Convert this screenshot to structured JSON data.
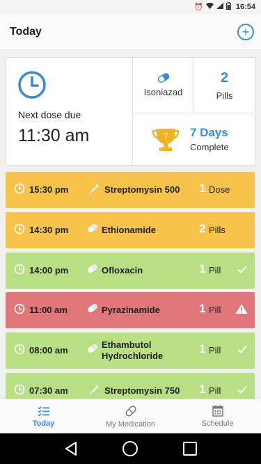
{
  "status_bar": {
    "time": "16:54"
  },
  "app_bar": {
    "title": "Today"
  },
  "summary": {
    "next_dose_label": "Next dose due",
    "next_dose_time": "11:30 am",
    "medication_name": "Isoniazad",
    "pill_count": "2",
    "pill_label": "Pills",
    "streak_value": "7 Days",
    "streak_label": "Complete",
    "trophy_number": "7"
  },
  "doses": [
    {
      "time": "15:30 pm",
      "medication": "Streptomysin 500",
      "count": "1",
      "unit": "Dose",
      "status": "upcoming",
      "color": "#f7c34b",
      "icon": "syringe-icon"
    },
    {
      "time": "14:30 pm",
      "medication": "Ethionamide",
      "count": "2",
      "unit": "Pills",
      "status": "upcoming",
      "color": "#f7c34b",
      "icon": "pill-icon"
    },
    {
      "time": "14:00 pm",
      "medication": "Ofloxacin",
      "count": "1",
      "unit": "Pill",
      "status": "taken",
      "color": "#b9df84",
      "icon": "pill-icon"
    },
    {
      "time": "11:00 am",
      "medication": "Pyrazinamide",
      "count": "1",
      "unit": "Pill",
      "status": "missed",
      "color": "#e0767a",
      "icon": "pill-icon"
    },
    {
      "time": "08:00 am",
      "medication": "Ethambutol Hydrochloride",
      "count": "1",
      "unit": "Pill",
      "status": "taken",
      "color": "#b9df84",
      "icon": "pill-icon"
    },
    {
      "time": "07:30 am",
      "medication": "Streptomysin 750",
      "count": "1",
      "unit": "Pill",
      "status": "taken",
      "color": "#b9df84",
      "icon": "syringe-icon"
    }
  ],
  "bottom_nav": {
    "items": [
      {
        "label": "Today",
        "icon": "list-icon",
        "active": true
      },
      {
        "label": "My Medication",
        "icon": "pill-icon",
        "active": false
      },
      {
        "label": "Schedule",
        "icon": "calendar-icon",
        "active": false
      }
    ]
  },
  "colors": {
    "accent": "#3a8ad6",
    "upcoming": "#f7c34b",
    "taken": "#b9df84",
    "missed": "#e0767a",
    "trophy": "#f0b323"
  }
}
